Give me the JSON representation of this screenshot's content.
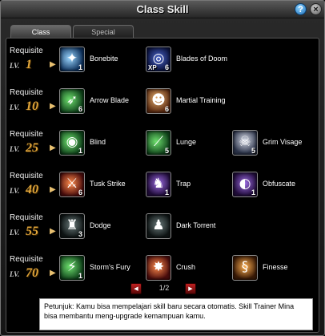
{
  "window": {
    "title": "Class Skill",
    "help_label": "?",
    "close_label": "×"
  },
  "tabs": [
    {
      "label": "Class",
      "active": true
    },
    {
      "label": "Special",
      "active": false
    }
  ],
  "requisite_label": "Requisite",
  "level_prefix": "LV.",
  "rows": [
    {
      "level": "1",
      "skills": [
        {
          "name": "Bonebite",
          "badge": "1",
          "icon": "claw-slash-icon"
        },
        {
          "name": "Blades of Doom",
          "badge": "6",
          "xp": "XP",
          "icon": "target-ring-icon"
        }
      ]
    },
    {
      "level": "10",
      "skills": [
        {
          "name": "Arrow Blade",
          "badge": "6",
          "icon": "arrow-blade-icon"
        },
        {
          "name": "Martial Training",
          "badge": "6",
          "icon": "warrior-portrait-icon"
        }
      ]
    },
    {
      "level": "25",
      "skills": [
        {
          "name": "Blind",
          "badge": "1",
          "icon": "eye-swirl-icon"
        },
        {
          "name": "Lunge",
          "badge": "5",
          "icon": "lunge-slash-icon"
        },
        {
          "name": "Grim Visage",
          "badge": "5",
          "icon": "skull-icon"
        }
      ]
    },
    {
      "level": "40",
      "skills": [
        {
          "name": "Tusk Strike",
          "badge": "6",
          "icon": "tusk-strike-icon"
        },
        {
          "name": "Trap",
          "badge": "1",
          "icon": "trap-figure-icon"
        },
        {
          "name": "Obfuscate",
          "badge": "1",
          "icon": "shadow-veil-icon"
        }
      ]
    },
    {
      "level": "55",
      "skills": [
        {
          "name": "Dodge",
          "badge": "3",
          "icon": "dodge-figure-icon"
        },
        {
          "name": "Dark Torrent",
          "badge": "",
          "icon": "hooded-figure-icon"
        }
      ]
    },
    {
      "level": "70",
      "skills": [
        {
          "name": "Storm's Fury",
          "badge": "1",
          "icon": "storm-blade-icon"
        },
        {
          "name": "Crush",
          "badge": "",
          "icon": "crush-slash-icon"
        },
        {
          "name": "Finesse",
          "badge": "",
          "icon": "finesse-swirl-icon"
        }
      ]
    }
  ],
  "pager": {
    "indicator": "1/2",
    "prev": "◀",
    "next": "▶"
  },
  "hint": {
    "text": "Petunjuk: Kamu bisa mempelajari skill baru secara otomatis. Skill Trainer Mina bisa membantu meng-upgrade kemampuan kamu."
  }
}
